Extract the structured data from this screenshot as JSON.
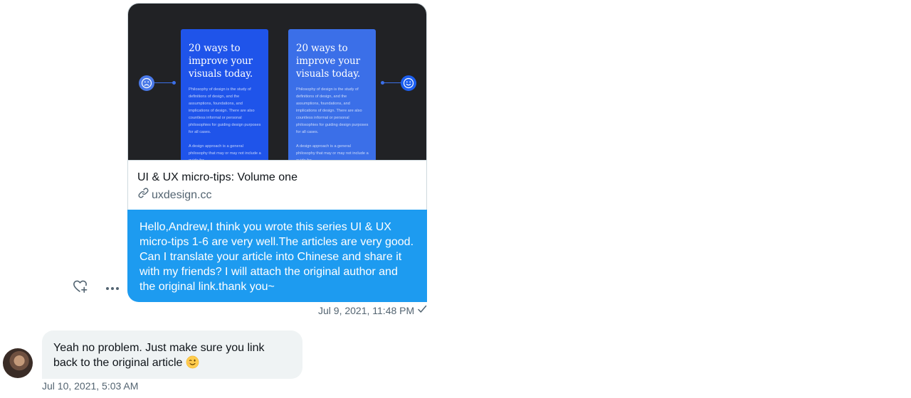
{
  "outgoing": {
    "preview": {
      "panel_left_title": "20 ways to improve your visuals today.",
      "panel_right_title": "20 ways to improve your visuals today.",
      "panel_body_1": "Philosophy of design is the study of definitions of design, and the assumptions, foundations, and implications of design. There are also countless informal or personal philosophies for guiding design purposes for all cases.",
      "panel_body_2": "A design approach is a general philosophy that may or may not include a guide for",
      "sad_icon": "sad-face-icon",
      "happy_icon": "happy-face-icon"
    },
    "link": {
      "title": "UI & UX micro-tips: Volume one",
      "domain": "uxdesign.cc"
    },
    "text": "Hello,Andrew,I think you wrote this series UI & UX micro-tips 1-6 are very well.The articles are very good. Can I translate your article into Chinese and share it with my friends? I will attach the original author and the original link.thank you~",
    "timestamp": "Jul 9, 2021, 11:48 PM",
    "status_icon": "checkmark-icon",
    "actions": [
      "heart-plus-icon",
      "more-icon"
    ]
  },
  "incoming": {
    "text": "Yeah no problem. Just make sure you link back to the original article",
    "emoji": "winking-face-emoji",
    "timestamp": "Jul 10, 2021, 5:03 AM"
  },
  "colors": {
    "accent": "#1d9bf0",
    "bubble_in": "#eff3f4",
    "secondary_text": "#536471",
    "border": "#cfd9de"
  }
}
